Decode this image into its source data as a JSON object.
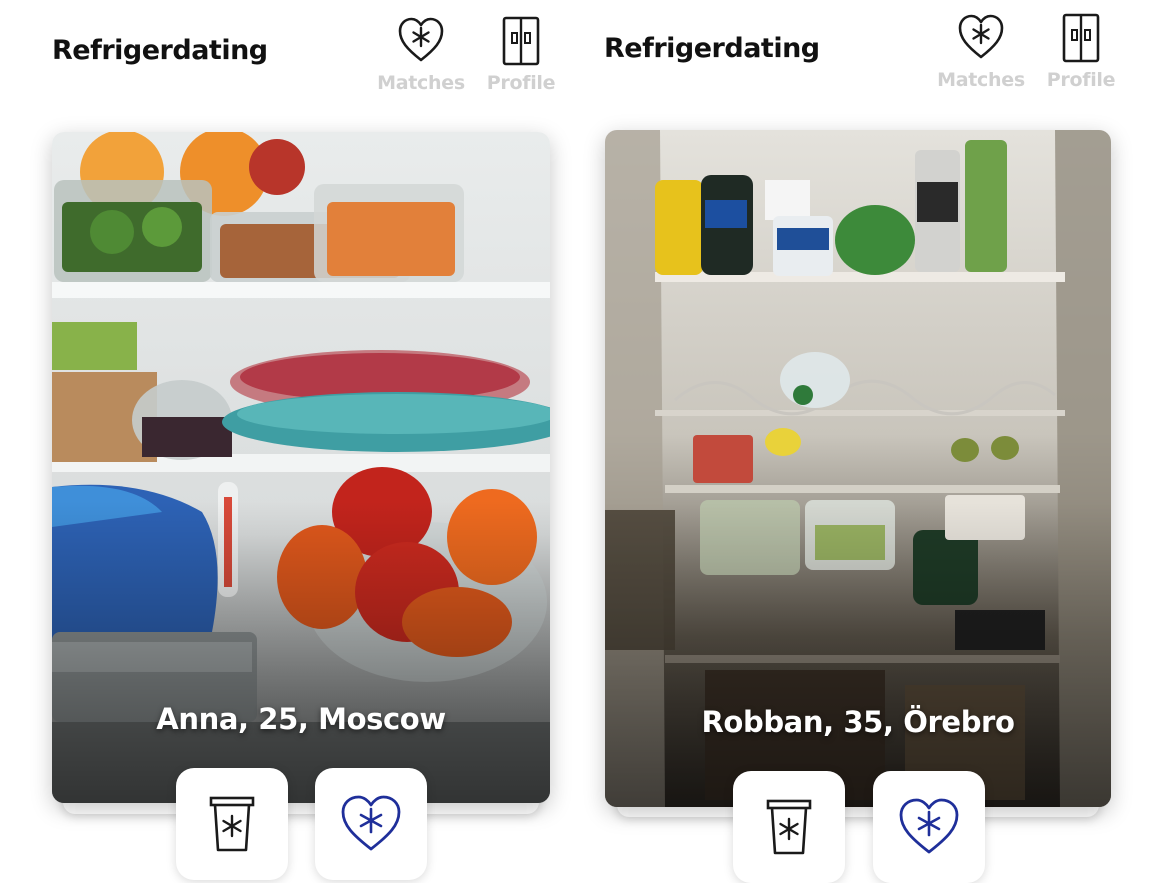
{
  "screens": [
    {
      "app_title": "Refrigerdating",
      "nav": {
        "matches_label": "Matches",
        "profile_label": "Profile"
      },
      "profile": {
        "caption": "Anna, 25, Moscow"
      },
      "icons": {
        "matches": "heart-snowflake-icon",
        "profile": "fridge-icon",
        "reject": "trash-bin-icon",
        "like": "heart-snowflake-icon"
      }
    },
    {
      "app_title": "Refrigerdating",
      "nav": {
        "matches_label": "Matches",
        "profile_label": "Profile"
      },
      "profile": {
        "caption": "Robban, 35, Örebro"
      },
      "icons": {
        "matches": "heart-snowflake-icon",
        "profile": "fridge-icon",
        "reject": "trash-bin-icon",
        "like": "heart-snowflake-icon"
      }
    }
  ],
  "colors": {
    "title_text": "#111111",
    "nav_inactive": "#d0d0d0",
    "icon_dark": "#1a1a1a",
    "like_accent": "#1f2f9a",
    "card_caption": "#ffffff"
  }
}
